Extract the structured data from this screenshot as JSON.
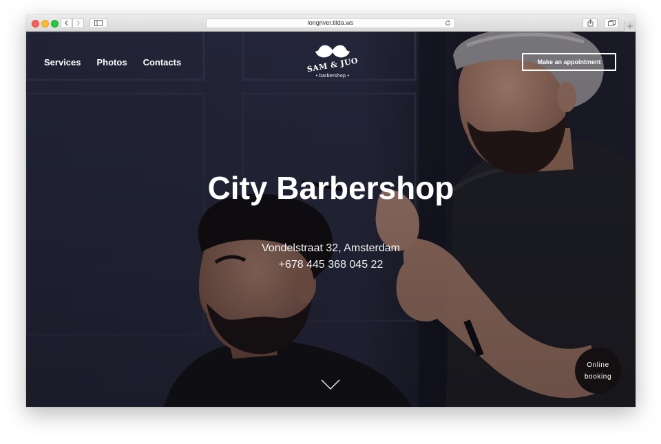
{
  "browser": {
    "url": "longriver.tilda.ws",
    "back_icon": "chevron-left-icon",
    "forward_icon": "chevron-right-icon",
    "sidebar_icon": "sidebar-icon",
    "reload_icon": "reload-icon",
    "share_icon": "share-icon",
    "tabs_icon": "tabs-icon",
    "new_tab_icon": "plus-icon"
  },
  "nav": {
    "items": [
      {
        "label": "Services"
      },
      {
        "label": "Photos"
      },
      {
        "label": "Contacts"
      }
    ]
  },
  "logo": {
    "name": "SAM & JUO",
    "subtitle": "• barbershop •",
    "icon": "mustache-icon"
  },
  "header": {
    "appointment_label": "Make an appointment"
  },
  "hero": {
    "title": "City Barbershop",
    "address": "Vondelstraat 32, Amsterdam",
    "phone": "+678 445 368 045 22",
    "scroll_icon": "chevron-down-icon"
  },
  "booking": {
    "line1": "Online",
    "line2": "booking"
  },
  "colors": {
    "overlay": "#1b1d2a",
    "text": "#ffffff",
    "booking_bg": "#140f10"
  }
}
